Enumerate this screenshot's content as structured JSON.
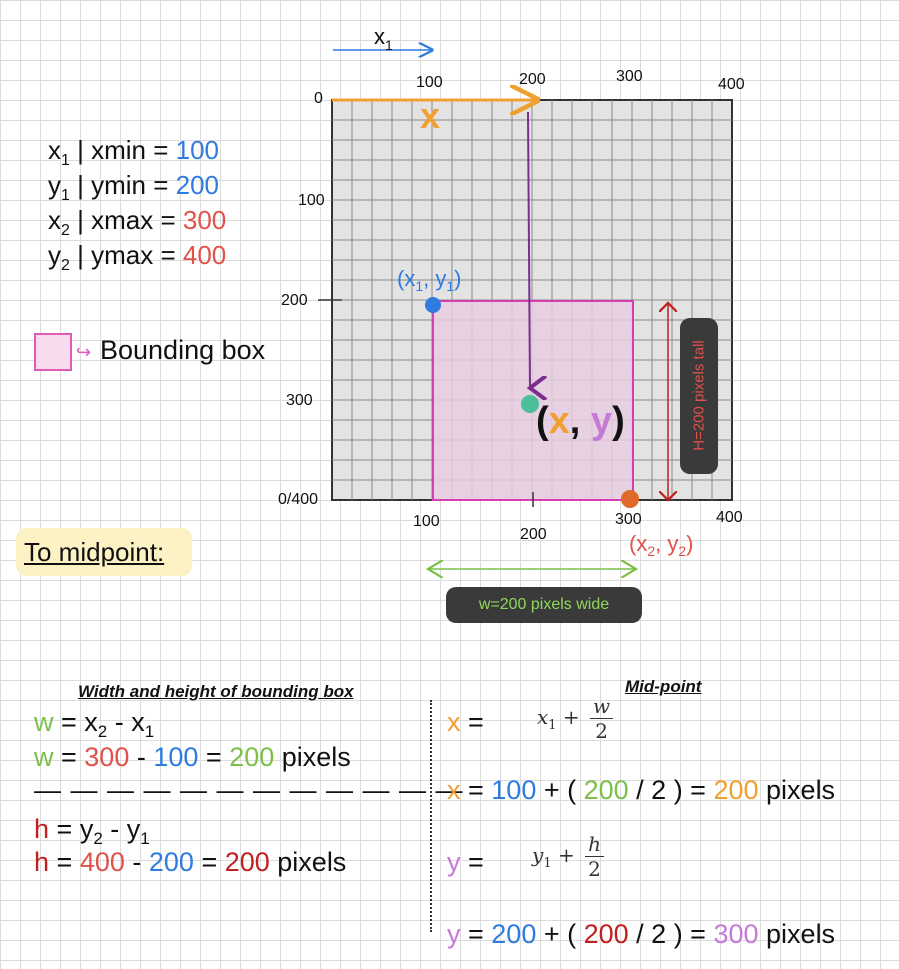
{
  "legend": {
    "x1_lbl": "x",
    "x1_sub": "1",
    "x1_rest": " | xmin  = ",
    "x1_val": "100",
    "y1_lbl": "y",
    "y1_sub": "1",
    "y1_rest": " | ymin  = ",
    "y1_val": "200",
    "x2_lbl": "x",
    "x2_sub": "2",
    "x2_rest": " | xmax = ",
    "x2_val": "300",
    "y2_lbl": "y",
    "y2_sub": "2",
    "y2_rest": " | ymax = ",
    "y2_val": "400",
    "bbox_label": "Bounding box"
  },
  "to_midpoint": "To midpoint:",
  "plot": {
    "axis_arrow_label": "x",
    "axis_arrow_sub": "1",
    "top_ticks": [
      "100",
      "200",
      "300",
      "400"
    ],
    "bottom_ticks": [
      "100",
      "200",
      "300",
      "400"
    ],
    "left_ticks": [
      "0",
      "100",
      "200",
      "300",
      "0/400"
    ],
    "x_marker": "x",
    "p1_label_a": "(x",
    "p1_label_sub": "1",
    "p1_label_b": ", y",
    "p1_label_sub2": "1",
    "p1_label_c": ")",
    "mid_open": "(",
    "mid_x": "x",
    "mid_comma": ", ",
    "mid_y": "y",
    "mid_close": ")",
    "p2_label_a": "(x",
    "p2_label_sub": "2",
    "p2_label_b": ", y",
    "p2_label_sub2": "2",
    "p2_label_c": ")",
    "height_note": "H=200 pixels tall",
    "width_note": "w=200 pixels wide"
  },
  "width_height": {
    "title": "Width and height of bounding box",
    "w_sym": "w",
    "eq": " =  ",
    "x2": "x",
    "x2_sub": "2",
    "minus": " -  ",
    "x1": "x",
    "x1_sub": "1",
    "w2_sym": "w",
    "w2_eq": " = ",
    "w2_a": "300",
    "w2_m": " - ",
    "w2_b": "100",
    "w2_e": " = ",
    "w2_r": "200",
    "w2_u": " pixels",
    "dashes": "— — — — — — — — — — — —",
    "h_sym": "h",
    "h_eq": "  =  ",
    "y2": "y",
    "y2_sub": "2",
    "h_minus": "  -  ",
    "y1": "y",
    "y1_sub": "1",
    "h2_sym": "h",
    "h2_eq": "  = ",
    "h2_a": "400",
    "h2_m": " - ",
    "h2_b": "200",
    "h2_e": " = ",
    "h2_r": "200",
    "h2_u": " pixels"
  },
  "midpoint": {
    "title": "Mid-point",
    "x_sym": "x",
    "x_eq": " =",
    "fx_var": "x",
    "fx_sub": "1",
    "fx_plus": " + ",
    "fx_num": "w",
    "fx_den": "2",
    "x2_sym": "x",
    "x2_eq": " =  ",
    "x2_a": "100",
    "x2_b": " + ( ",
    "x2_c": "200",
    "x2_d": " / 2 ) = ",
    "x2_r": "200",
    "x2_u": " pixels",
    "y_sym": "y",
    "y_eq": " =",
    "fy_var": "y",
    "fy_sub": "1",
    "fy_plus": " + ",
    "fy_num": "h",
    "fy_den": "2",
    "y2_sym": "y",
    "y2_eq": " = ",
    "y2_a": "200",
    "y2_b": " + ( ",
    "y2_c": "200",
    "y2_d": " / 2 ) = ",
    "y2_r": "300",
    "y2_u": " pixels"
  },
  "colors": {
    "blue": "#2f7be0",
    "red": "#e0524a",
    "dark_red": "#c21f1f",
    "green": "#7cc04a",
    "orange": "#f0a030",
    "purple": "#c57ad6",
    "bbox_fill": "#e6cce0",
    "bbox_stroke": "#d63fb0",
    "teal": "#4cbf9a"
  }
}
